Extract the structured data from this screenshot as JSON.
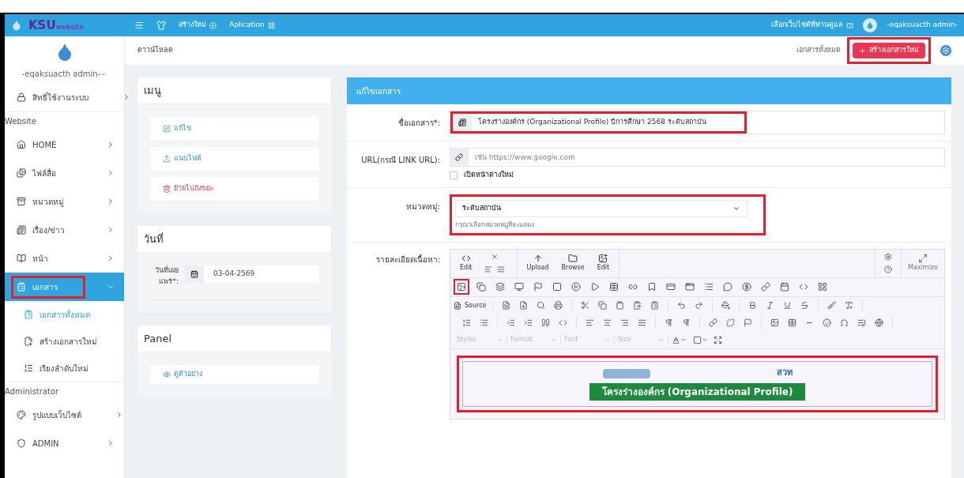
{
  "header": {
    "logo": "KSU",
    "logo_sub": "website",
    "nav": [
      {
        "label": "สร้างใหม่"
      },
      {
        "label": "Aplication"
      }
    ],
    "site_select": "เลือกเว็บไซต์ที่ท่านดูแล",
    "user": "-eqaksuacth admin-"
  },
  "sidebar": {
    "user": "-eqaksuacth admin-",
    "items": [
      {
        "kind": "item",
        "label": "สิทธิ์ใช้งานระบบ",
        "selected": false,
        "highlighted": false
      },
      {
        "kind": "section",
        "label": "Website"
      },
      {
        "kind": "item",
        "label": "HOME",
        "selected": false,
        "highlighted": false
      },
      {
        "kind": "item",
        "label": "ไฟล์สื่อ",
        "selected": false,
        "highlighted": false
      },
      {
        "kind": "item",
        "label": "หมวดหมู่",
        "selected": false,
        "highlighted": false
      },
      {
        "kind": "item",
        "label": "เรื่อง/ข่าว",
        "selected": false,
        "highlighted": false
      },
      {
        "kind": "item",
        "label": "หน้า",
        "selected": false,
        "highlighted": false
      },
      {
        "kind": "item",
        "label": "เอกสาร",
        "selected": true,
        "expanded": true,
        "highlighted": true,
        "children": [
          {
            "label": "เอกสารทั้งหมด",
            "selected": true
          },
          {
            "label": "สร้างเอกสารใหม่",
            "selected": false
          },
          {
            "label": "เรียงลำดับใหม่",
            "selected": false
          }
        ]
      },
      {
        "kind": "section",
        "label": "Administrator"
      },
      {
        "kind": "item",
        "label": "รูปแบบเว็บไซต์",
        "selected": false,
        "highlighted": false
      },
      {
        "kind": "item",
        "label": "ADMIN",
        "selected": false,
        "highlighted": false
      }
    ]
  },
  "breadcrumb": "ดาวน์โหลด",
  "actions": {
    "link": "เอกสารทั้งหมด",
    "create_button": "สร้างเอกสารใหม่",
    "create_highlighted": true
  },
  "menu_panel": {
    "title": "เมนู",
    "items": [
      {
        "kind": "edit",
        "label": "แก้ไข"
      },
      {
        "kind": "attach",
        "label": "แนบไฟล์"
      },
      {
        "kind": "trash",
        "label": "ย้ายไปถังขยะ"
      }
    ]
  },
  "date_panel": {
    "title": "วันที่",
    "label": "วันที่เผยแพร่*:",
    "value": "03-04-2569"
  },
  "extra_panel": {
    "title": "Panel",
    "items": [
      {
        "label": "ดูตัวอย่าง"
      }
    ]
  },
  "form": {
    "title": "แก้ไขเอกสาร",
    "name": {
      "label": "ชื่อเอกสาร*:",
      "value": "โครงร่างองค์กร (Organizational Profile) ปีการศึกษา 2568 ระดับสถาบัน",
      "highlighted": true
    },
    "url": {
      "label": "URL(กรณี LINK URL):",
      "placeholder": "เช่น https://www.google.com",
      "checkbox": {
        "label": "เปิดหน้าต่างใหม่",
        "checked": false
      }
    },
    "category": {
      "label": "หมวดหมู่:",
      "value": "ระดับสถาบัน",
      "hint": "กรุณาเลือกหมวดหมู่ที่จะแสดง",
      "highlighted": true
    },
    "editor": {
      "label": "รายละเอียดเนื้อหา:",
      "top_buttons": [
        {
          "label": "Edit"
        },
        {
          "label": "Upload"
        },
        {
          "label": "Browse"
        },
        {
          "label": "Edit"
        }
      ],
      "maximize": "Maximize",
      "source": "Source",
      "dropdowns": [
        "Styles",
        "Format",
        "Font",
        "Size"
      ],
      "first_tool_highlighted": true,
      "content": {
        "highlighted": true,
        "banner_title": "โครงร่างองค์กร (Organizational Profile)",
        "banner_logo": "สวท"
      }
    }
  }
}
